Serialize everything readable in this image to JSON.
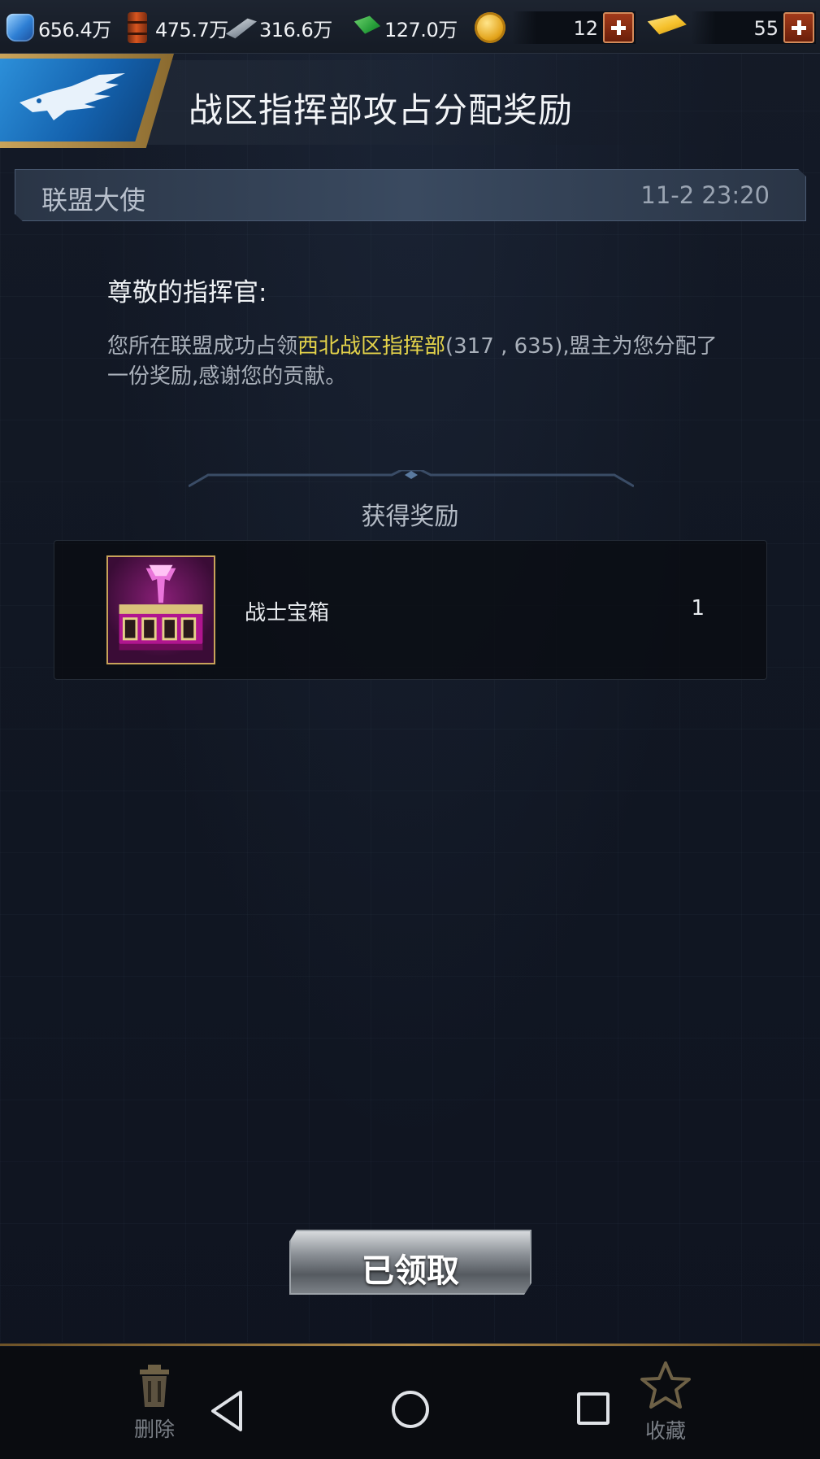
{
  "resources": [
    {
      "icon": "gem-icon",
      "value": "656.4万"
    },
    {
      "icon": "oil-barrel-icon",
      "value": "475.7万"
    },
    {
      "icon": "steel-icon",
      "value": "316.6万"
    },
    {
      "icon": "cash-icon",
      "value": "127.0万"
    }
  ],
  "counters": {
    "coin": {
      "value": "12",
      "icon": "gold-coin-icon"
    },
    "gold": {
      "value": "55",
      "icon": "gold-bar-icon"
    }
  },
  "page": {
    "title": "战区指挥部攻占分配奖励"
  },
  "mail": {
    "sender": "联盟大使",
    "time": "11-2 23:20",
    "greeting": "尊敬的指挥官:",
    "body_before": "您所在联盟成功占领",
    "body_highlight": "西北战区指挥部",
    "body_after": "(317 , 635),盟主为您分配了一份奖励,感谢您的贡献。"
  },
  "reward": {
    "section_title": "获得奖励",
    "items": [
      {
        "name": "战士宝箱",
        "count": "1",
        "icon": "warrior-chest-icon"
      }
    ]
  },
  "actions": {
    "claimed_label": "已领取",
    "delete_label": "删除",
    "favorite_label": "收藏"
  },
  "colors": {
    "highlight": "#e4d34a",
    "accent_gold": "#c9a35a",
    "emblem_blue": "#1462ae"
  }
}
